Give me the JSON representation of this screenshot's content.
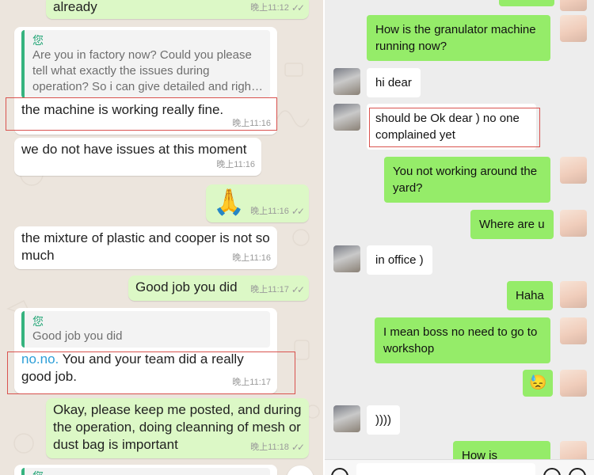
{
  "left": {
    "messages": [
      {
        "type": "out",
        "text": "already",
        "time": "晚上11:12"
      },
      {
        "type": "in",
        "quote_author": "您",
        "quote_text": "Are you in factory now? Could you please tell what exactly the issues during operation? So i can give detailed and righ…",
        "text": "the machine is working really fine.",
        "time": "晚上11:16"
      },
      {
        "type": "in",
        "text": "we do not have issues at this moment",
        "time": "晚上11:16"
      },
      {
        "type": "out",
        "emoji": "🙏",
        "time": "晚上11:16"
      },
      {
        "type": "in",
        "text": "the mixture of plastic and cooper is not so much",
        "time": "晚上11:16"
      },
      {
        "type": "out",
        "text": "Good job you did",
        "time": "晚上11:17"
      },
      {
        "type": "in",
        "quote_author": "您",
        "quote_text": "Good job you did",
        "link_text": "no.no.",
        "text": " You and your team did a really good job.",
        "time": "晚上11:17"
      },
      {
        "type": "out",
        "text": "Okay, please keep me posted, and during the operation, doing cleanning of mesh or dust bag is important",
        "time": "晚上11:18"
      },
      {
        "type": "in",
        "quote_author": "您",
        "partial": true
      }
    ]
  },
  "right": {
    "messages": [
      {
        "side": "out",
        "text": "How is the granulator machine running now?"
      },
      {
        "side": "in",
        "text": "hi dear"
      },
      {
        "side": "in",
        "text": "should be Ok dear ) no one complained yet"
      },
      {
        "side": "out",
        "text": "You not working around the yard?"
      },
      {
        "side": "out",
        "text": "Where are u"
      },
      {
        "side": "in",
        "text": "in office )"
      },
      {
        "side": "out",
        "text": "Haha"
      },
      {
        "side": "out",
        "text": "I mean boss no need to go to workshop"
      },
      {
        "side": "out",
        "emoji": "😓"
      },
      {
        "side": "in",
        "text": "))))"
      },
      {
        "side": "out",
        "text": "How is business"
      }
    ],
    "input_icons": [
      "voice-icon",
      "emoji-icon",
      "plus-icon"
    ]
  },
  "colors": {
    "wa_out": "#dcf8c6",
    "wa_in": "#ffffff",
    "wa_bg": "#ece5dd",
    "wx_out": "#95ec69",
    "wx_bg": "#ededed",
    "highlight": "#d9534f",
    "quote_accent": "#1fa474"
  }
}
